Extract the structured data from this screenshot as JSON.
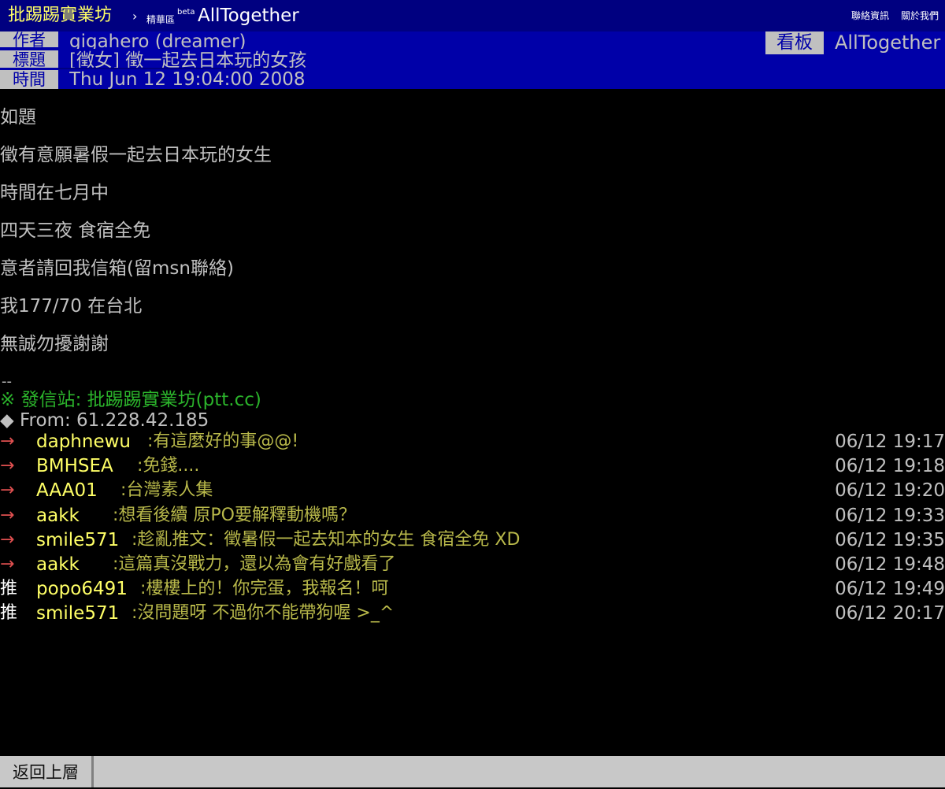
{
  "topbar": {
    "site_title": "批踢踢實業坊",
    "arrow": "›",
    "section": "精華區",
    "beta": "beta",
    "board": "AllTogether",
    "contact_link": "聯絡資訊",
    "about_link": "關於我們"
  },
  "header": {
    "author_label": "作者",
    "author_value": "gigahero (dreamer)",
    "title_label": "標題",
    "title_value": "[徵女] 徵一起去日本玩的女孩",
    "time_label": "時間",
    "time_value": "Thu Jun 12 19:04:00 2008",
    "board_label": "看板",
    "board_value": "AllTogether"
  },
  "body": {
    "lines": [
      "如題",
      "徵有意願暑假一起去日本玩的女生",
      "時間在七月中",
      "四天三夜 食宿全免",
      "意者請回我信箱(留msn聯絡)",
      "我177/70 在台北",
      "無誠勿擾謝謝"
    ],
    "sig_dash": "--",
    "sig_origin": "※ 發信站: 批踢踢實業坊(ptt.cc)",
    "sig_from": "◆ From: 61.228.42.185"
  },
  "pushes": [
    {
      "tag": "→",
      "user": "daphnewu",
      "content": ":有這麼好的事@@!",
      "time": "06/12 19:17"
    },
    {
      "tag": "→",
      "user": "BMHSEA",
      "content": ":免錢....",
      "time": "06/12 19:18"
    },
    {
      "tag": "→",
      "user": "AAA01",
      "content": ":台灣素人集",
      "time": "06/12 19:20"
    },
    {
      "tag": "→",
      "user": "aakk",
      "content": ":想看後續 原PO要解釋動機嗎？",
      "time": "06/12 19:33"
    },
    {
      "tag": "→",
      "user": "smile571",
      "content": ":趁亂推文：徵暑假一起去知本的女生 食宿全免 XD",
      "time": "06/12 19:35"
    },
    {
      "tag": "→",
      "user": "aakk",
      "content": ":這篇真沒戰力，還以為會有好戲看了",
      "time": "06/12 19:48"
    },
    {
      "tag": "推",
      "user": "popo6491",
      "content": ":樓樓上的！你完蛋，我報名！呵",
      "time": "06/12 19:49"
    },
    {
      "tag": "推",
      "user": "smile571",
      "content": ":沒問題呀 不過你不能帶狗喔 >_^",
      "time": "06/12 20:17"
    }
  ],
  "footer": {
    "back_label": "返回上層"
  }
}
